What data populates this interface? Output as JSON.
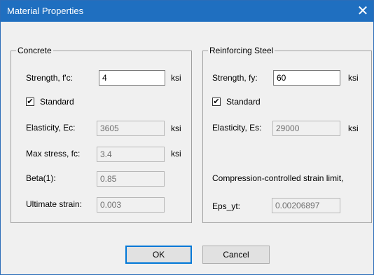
{
  "window": {
    "title": "Material Properties"
  },
  "concrete": {
    "legend": "Concrete",
    "strength_label": "Strength, f'c:",
    "strength_value": "4",
    "strength_unit": "ksi",
    "standard_label": "Standard",
    "standard_checked": true,
    "elasticity_label": "Elasticity, Ec:",
    "elasticity_value": "3605",
    "elasticity_unit": "ksi",
    "maxstress_label": "Max stress, fc:",
    "maxstress_value": "3.4",
    "maxstress_unit": "ksi",
    "beta_label": "Beta(1):",
    "beta_value": "0.85",
    "ultimate_label": "Ultimate strain:",
    "ultimate_value": "0.003"
  },
  "steel": {
    "legend": "Reinforcing Steel",
    "strength_label": "Strength, fy:",
    "strength_value": "60",
    "strength_unit": "ksi",
    "standard_label": "Standard",
    "standard_checked": true,
    "elasticity_label": "Elasticity, Es:",
    "elasticity_value": "29000",
    "elasticity_unit": "ksi",
    "compression_label": "Compression-controlled strain limit,",
    "eps_label": "Eps_yt:",
    "eps_value": "0.00206897"
  },
  "buttons": {
    "ok": "OK",
    "cancel": "Cancel"
  },
  "icons": {
    "close": "close-icon",
    "check": "checkmark-icon"
  },
  "colors": {
    "titlebar": "#1f6fc0",
    "default_button_border": "#0078d7"
  }
}
